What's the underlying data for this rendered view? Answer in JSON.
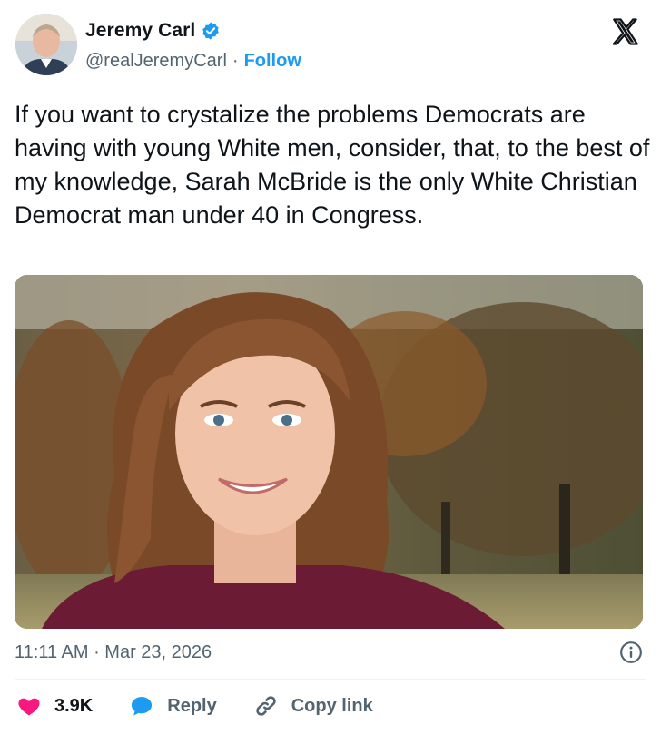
{
  "author": {
    "display_name": "Jeremy Carl",
    "handle": "@realJeremyCarl",
    "separator": "·",
    "follow_label": "Follow",
    "verified_icon": "verified-badge-icon"
  },
  "platform": {
    "logo_icon": "x-logo-icon"
  },
  "tweet": {
    "text": "If you want to crystalize the problems Democrats are having with young White men, consider, that, to the best of my knowledge, Sarah McBride is the only White Christian Democrat man under 40 in Congress.",
    "timestamp": "11:11 AM · Mar 23, 2026"
  },
  "actions": {
    "like_count": "3.9K",
    "reply_label": "Reply",
    "copy_link_label": "Copy link"
  },
  "colors": {
    "accent": "#1d9bf0",
    "like": "#f91880",
    "text": "#0f1419",
    "muted": "#536471"
  }
}
